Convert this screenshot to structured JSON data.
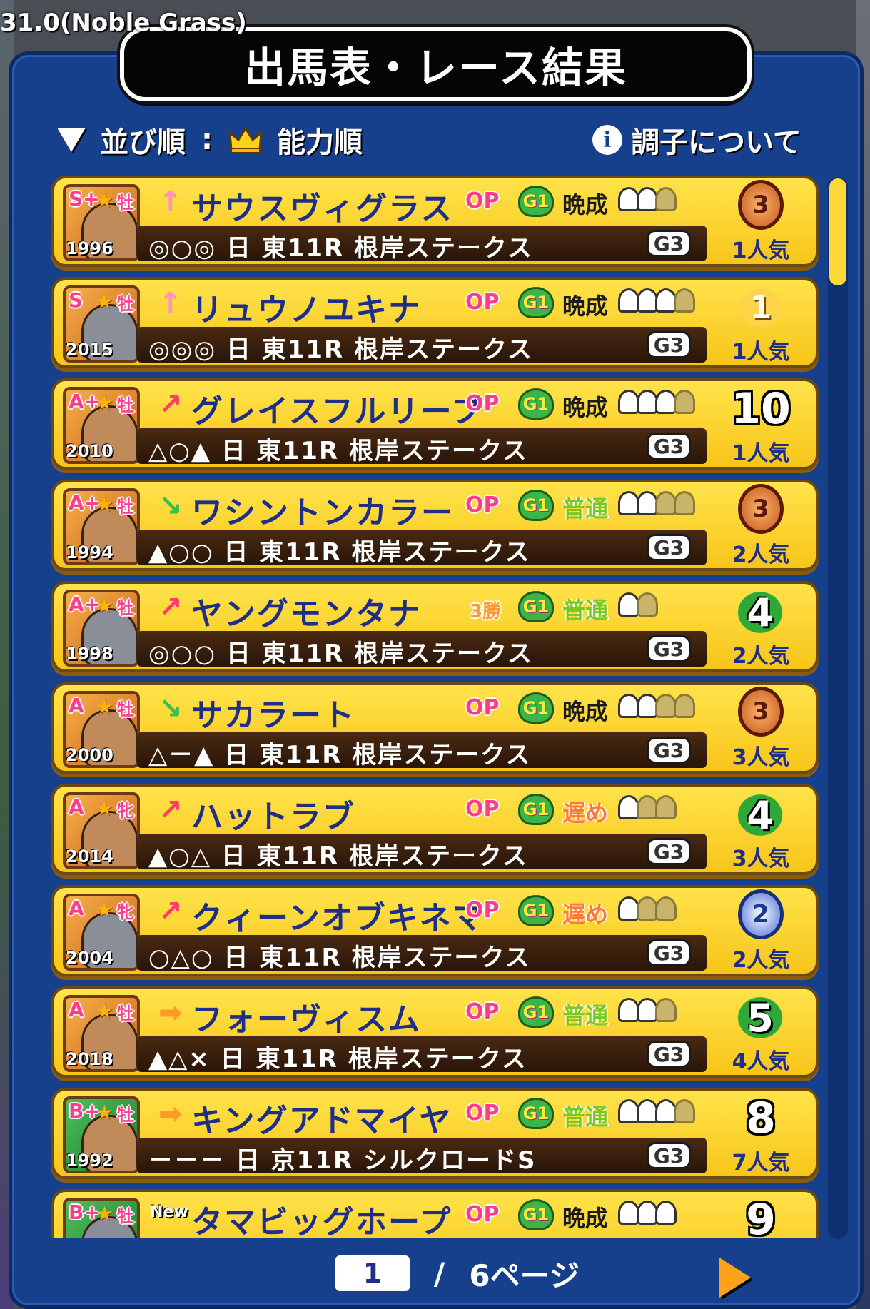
{
  "version_text": "31.0(Noble Grass)",
  "title": "出馬表・レース結果",
  "sort": {
    "label": "並び順",
    "colon": ":",
    "value": "能力順"
  },
  "condition_label": "調子について",
  "colors": {
    "accent": "#163f8c",
    "row": "#ffe34a",
    "name": "#1e2f8a"
  },
  "rows": [
    {
      "rank": "S+",
      "sex": "牡",
      "year": "1996",
      "arrow": "↑",
      "arrow_type": "up",
      "name": "サウスヴィグラス",
      "class": "OP",
      "g1": "G1",
      "growth": "晩成",
      "growth_type": "late-bold",
      "shoes_on": 2,
      "shoes_total": 3,
      "marks": "◎○◎ 日 東11R 根岸ステークス",
      "grade": "G3",
      "result": "3",
      "result_type": "bronze",
      "popularity": "1人気",
      "portrait": "gold"
    },
    {
      "rank": "S",
      "sex": "牡",
      "year": "2015",
      "arrow": "↑",
      "arrow_type": "up",
      "name": "リュウノユキナ",
      "class": "OP",
      "g1": "G1",
      "growth": "晩成",
      "growth_type": "late-bold",
      "shoes_on": 3,
      "shoes_total": 4,
      "marks": "◎◎◎ 日 東11R 根岸ステークス",
      "grade": "G3",
      "result": "1",
      "result_type": "trophy",
      "popularity": "1人気",
      "portrait": "gold"
    },
    {
      "rank": "A+",
      "sex": "牡",
      "year": "2010",
      "arrow": "↗",
      "arrow_type": "diag-up",
      "name": "グレイスフルリープ",
      "class": "OP",
      "g1": "G1",
      "growth": "晩成",
      "growth_type": "late-bold",
      "shoes_on": 3,
      "shoes_total": 4,
      "marks": "△○▲ 日 東11R 根岸ステークス",
      "grade": "G3",
      "result": "10",
      "result_type": "plain",
      "popularity": "1人気",
      "portrait": "gold"
    },
    {
      "rank": "A+",
      "sex": "牡",
      "year": "1994",
      "arrow": "↘",
      "arrow_type": "diag-down",
      "name": "ワシントンカラー",
      "class": "OP",
      "g1": "G1",
      "growth": "普通",
      "growth_type": "normal",
      "shoes_on": 2,
      "shoes_total": 4,
      "marks": "▲○○ 日 東11R 根岸ステークス",
      "grade": "G3",
      "result": "3",
      "result_type": "bronze",
      "popularity": "2人気",
      "portrait": "gold"
    },
    {
      "rank": "A+",
      "sex": "牡",
      "year": "1998",
      "arrow": "↗",
      "arrow_type": "diag-up",
      "name": "ヤングモンタナ",
      "class": "3勝",
      "g1": "G1",
      "growth": "普通",
      "growth_type": "normal",
      "shoes_on": 1,
      "shoes_total": 2,
      "marks": "◎○○ 日 東11R 根岸ステークス",
      "grade": "G3",
      "result": "4",
      "result_type": "wreath",
      "popularity": "2人気",
      "portrait": "gold"
    },
    {
      "rank": "A",
      "sex": "牡",
      "year": "2000",
      "arrow": "↘",
      "arrow_type": "diag-down",
      "name": "サカラート",
      "class": "OP",
      "g1": "G1",
      "growth": "晩成",
      "growth_type": "late-bold",
      "shoes_on": 2,
      "shoes_total": 4,
      "marks": "△－▲ 日 東11R 根岸ステークス",
      "grade": "G3",
      "result": "3",
      "result_type": "bronze",
      "popularity": "3人気",
      "portrait": "gold"
    },
    {
      "rank": "A",
      "sex": "牝",
      "year": "2014",
      "arrow": "↗",
      "arrow_type": "diag-up",
      "name": "ハットラブ",
      "class": "OP",
      "g1": "G1",
      "growth": "遅め",
      "growth_type": "late",
      "shoes_on": 1,
      "shoes_total": 3,
      "marks": "▲○△ 日 東11R 根岸ステークス",
      "grade": "G3",
      "result": "4",
      "result_type": "wreath",
      "popularity": "3人気",
      "portrait": "gold"
    },
    {
      "rank": "A",
      "sex": "牝",
      "year": "2004",
      "arrow": "↗",
      "arrow_type": "diag-up",
      "name": "クィーンオブキネマ",
      "class": "OP",
      "g1": "G1",
      "growth": "遅め",
      "growth_type": "late",
      "shoes_on": 1,
      "shoes_total": 3,
      "marks": "○△○ 日 東11R 根岸ステークス",
      "grade": "G3",
      "result": "2",
      "result_type": "silver",
      "popularity": "2人気",
      "portrait": "gold"
    },
    {
      "rank": "A",
      "sex": "牡",
      "year": "2018",
      "arrow": "➡",
      "arrow_type": "right",
      "name": "フォーヴィスム",
      "class": "OP",
      "g1": "G1",
      "growth": "普通",
      "growth_type": "normal",
      "shoes_on": 2,
      "shoes_total": 3,
      "marks": "▲△× 日 東11R 根岸ステークス",
      "grade": "G3",
      "result": "5",
      "result_type": "wreath",
      "popularity": "4人気",
      "portrait": "gold"
    },
    {
      "rank": "B+",
      "sex": "牡",
      "year": "1992",
      "arrow": "➡",
      "arrow_type": "right",
      "name": "キングアドマイヤ",
      "class": "OP",
      "g1": "G1",
      "growth": "普通",
      "growth_type": "normal",
      "shoes_on": 3,
      "shoes_total": 4,
      "marks": "－－－ 日 京11R シルクロードS",
      "grade": "G3",
      "result": "8",
      "result_type": "plain",
      "popularity": "7人気",
      "portrait": "green"
    },
    {
      "rank": "B+",
      "sex": "牡",
      "year": "",
      "arrow": "New",
      "arrow_type": "new",
      "name": "タマビッグホープ",
      "class": "OP",
      "g1": "G1",
      "growth": "晩成",
      "growth_type": "late-bold",
      "shoes_on": 3,
      "shoes_total": 3,
      "marks": "",
      "grade": "",
      "result": "9",
      "result_type": "plain",
      "popularity": "",
      "portrait": "green"
    }
  ],
  "pager": {
    "current": "1",
    "slash": "/",
    "total": "6ページ"
  }
}
